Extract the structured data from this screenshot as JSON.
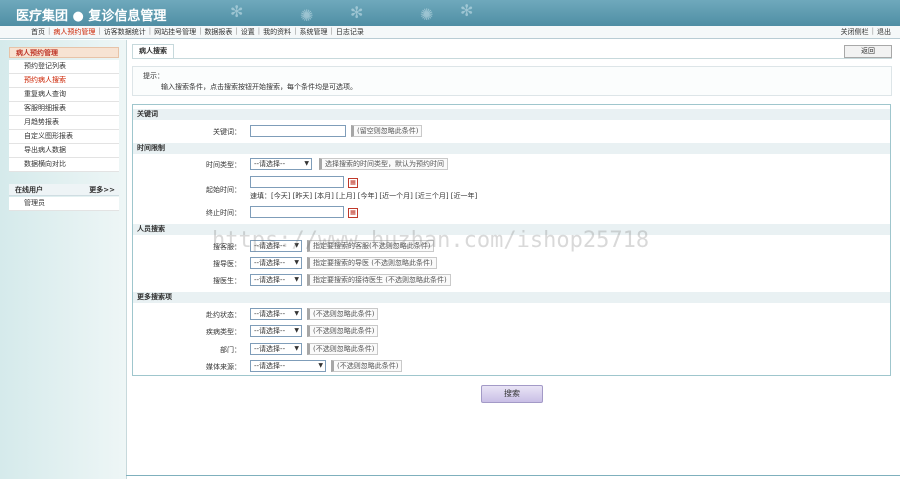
{
  "header": {
    "title": "医疗集团 ● 复诊信息管理"
  },
  "nav": {
    "items": [
      "首页",
      "病人预约管理",
      "访客数据统计",
      "网站挂号管理",
      "数据报表",
      "设置",
      "我的资料",
      "系统管理",
      "日志记录"
    ],
    "right": [
      "关闭侧栏",
      "退出"
    ]
  },
  "sidebar": {
    "head": "病人预约管理",
    "items": [
      "预约登记列表",
      "预约病人搜索",
      "重复病人查询",
      "客服明细报表",
      "月趋势报表",
      "自定义图形报表",
      "导出病人数据",
      "数据横向对比"
    ],
    "online_head": "在线用户",
    "online_more": "更多>>",
    "users": [
      "管理员"
    ]
  },
  "main": {
    "tab": "病人搜索",
    "back": "返回",
    "tip_title": "提示：",
    "tip_text": "输入搜索条件，点击搜索按钮开始搜索，每个条件均是可选项。",
    "sections": {
      "keyword": "关键词",
      "time": "时间限制",
      "person": "人员搜索",
      "more": "更多搜索项"
    },
    "fields": {
      "keyword": {
        "label": "关键词：",
        "hint": "(留空则忽略此条件)"
      },
      "time_type": {
        "label": "时间类型：",
        "value": "--请选择--",
        "hint": "选择搜索的时间类型，默认为预约时间"
      },
      "start": {
        "label": "起始时间："
      },
      "quick": "速填：[今天] [昨天] [本月] [上月] [今年] [近一个月] [近三个月] [近一年]",
      "end": {
        "label": "终止时间："
      },
      "author": {
        "label": "搜客服：",
        "value": "--请选择--",
        "hint": "指定要搜索的客服(不选则忽略此条件)"
      },
      "guide": {
        "label": "搜导医：",
        "value": "--请选择--",
        "hint": "指定要搜索的导医 (不选则忽略此条件)"
      },
      "doctor": {
        "label": "搜医生：",
        "value": "--请选择--",
        "hint": "指定要搜索的接待医生 (不选则忽略此条件)"
      },
      "status": {
        "label": "赴约状态：",
        "value": "--请选择--",
        "hint": "(不选则忽略此条件)"
      },
      "disease": {
        "label": "疾病类型：",
        "value": "--请选择--",
        "hint": "(不选则忽略此条件)"
      },
      "dept": {
        "label": "部门：",
        "value": "--请选择--",
        "hint": "(不选则忽略此条件)"
      },
      "media": {
        "label": "媒体来源：",
        "value": "--请选择--",
        "hint": "(不选则忽略此条件)"
      }
    },
    "search": "搜索"
  },
  "watermark": "https://www.huzhan.com/ishop25718",
  "colors": {
    "header": "#5a9bb0",
    "active": "#cc2200",
    "form_border": "#9fc6cd"
  }
}
